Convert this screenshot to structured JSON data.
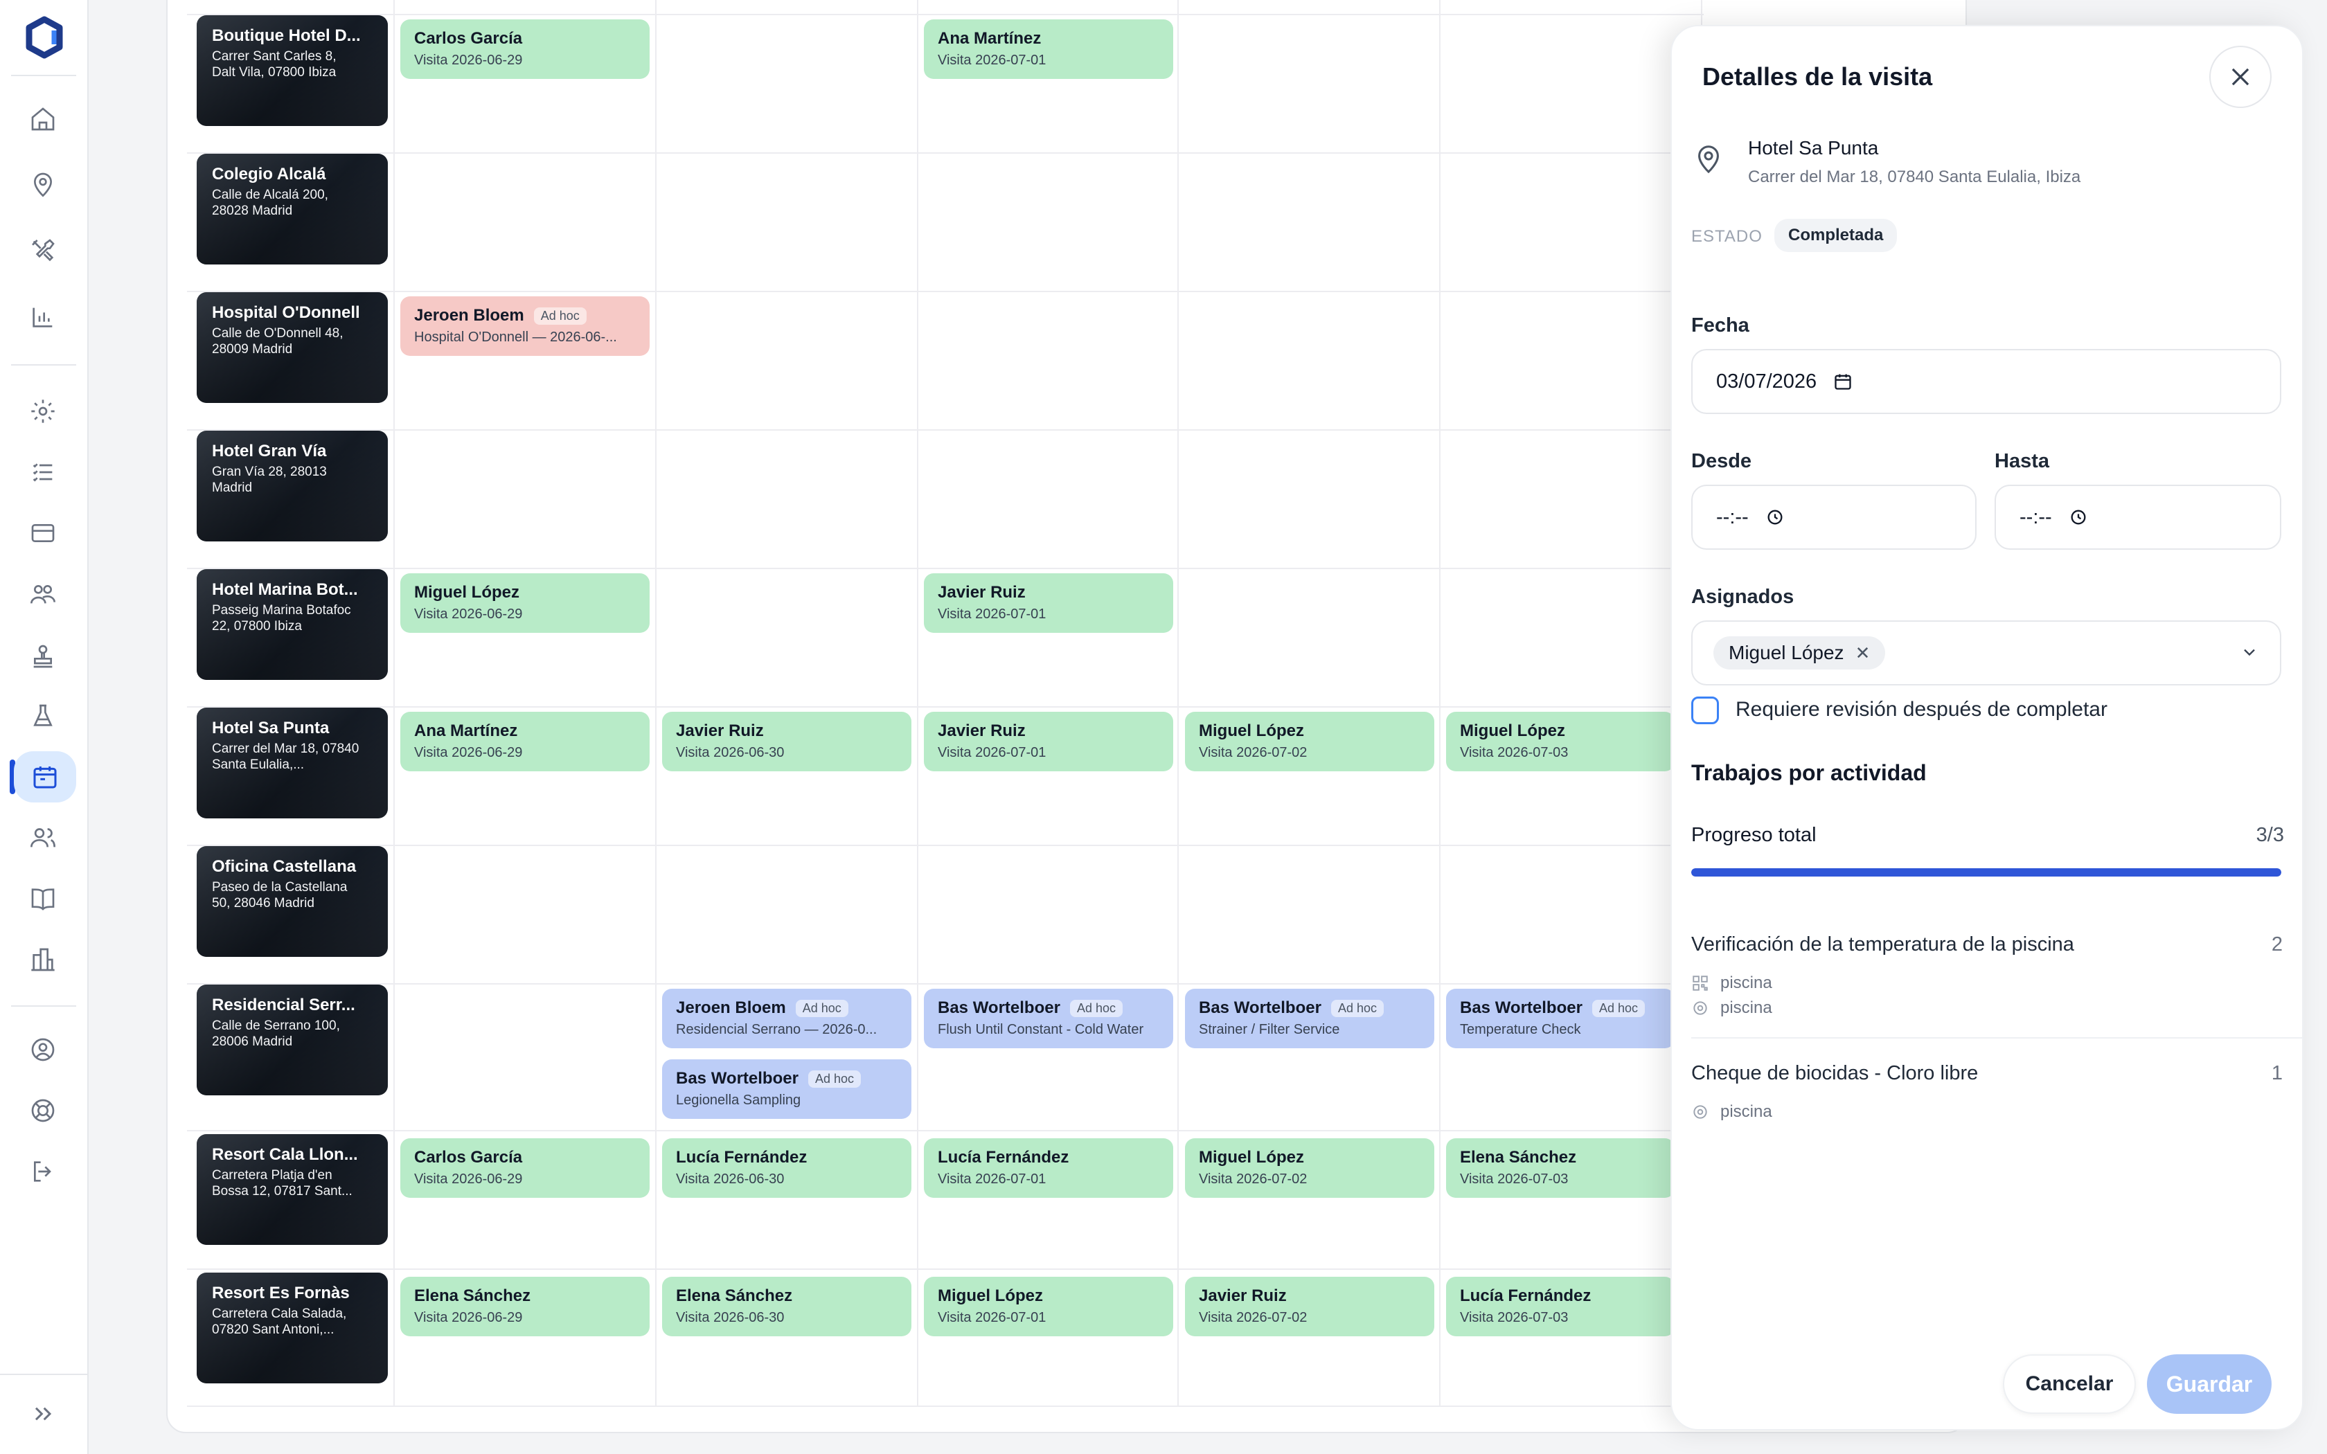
{
  "sidebar": {
    "items": [
      {
        "icon": "home-icon"
      },
      {
        "icon": "map-pin-icon"
      },
      {
        "icon": "tools-icon"
      },
      {
        "icon": "bar-chart-icon"
      },
      {
        "icon": "gear-icon"
      },
      {
        "icon": "checklist-icon"
      },
      {
        "icon": "credit-card-icon"
      },
      {
        "icon": "team-icon"
      },
      {
        "icon": "stamp-icon"
      },
      {
        "icon": "flask-icon"
      },
      {
        "icon": "calendar-icon",
        "active": true
      },
      {
        "icon": "users-icon"
      },
      {
        "icon": "book-icon"
      },
      {
        "icon": "buildings-icon"
      },
      {
        "icon": "account-icon"
      },
      {
        "icon": "support-icon"
      },
      {
        "icon": "logout-icon"
      },
      {
        "icon": "expand-icon"
      }
    ]
  },
  "locations": [
    {
      "name": "Boutique Hotel D...",
      "address": "Carrer Sant Carles 8, Dalt Vila, 07800 Ibiza"
    },
    {
      "name": "Colegio Alcalá",
      "address": "Calle de Alcalá 200, 28028 Madrid"
    },
    {
      "name": "Hospital O'Donnell",
      "address": "Calle de O'Donnell 48, 28009 Madrid"
    },
    {
      "name": "Hotel Gran Vía",
      "address": "Gran Vía 28, 28013 Madrid"
    },
    {
      "name": "Hotel Marina Bot...",
      "address": "Passeig Marina Botafoc 22, 07800 Ibiza"
    },
    {
      "name": "Hotel Sa Punta",
      "address": "Carrer del Mar 18, 07840 Santa Eulalia,..."
    },
    {
      "name": "Oficina Castellana",
      "address": "Paseo de la Castellana 50, 28046 Madrid"
    },
    {
      "name": "Residencial Serr...",
      "address": "Calle de Serrano 100, 28006 Madrid"
    },
    {
      "name": "Resort Cala Llon...",
      "address": "Carretera Platja d'en Bossa 12, 07817 Sant..."
    },
    {
      "name": "Resort Es Fornàs",
      "address": "Carretera Cala Salada, 07820 Sant Antoni,..."
    }
  ],
  "visits": [
    {
      "row": 0,
      "col": 0,
      "color": "g",
      "name": "Carlos García",
      "sub": "Visita 2026-06-29"
    },
    {
      "row": 0,
      "col": 2,
      "color": "g",
      "name": "Ana Martínez",
      "sub": "Visita 2026-07-01"
    },
    {
      "row": 2,
      "col": 0,
      "color": "r",
      "name": "Jeroen Bloem",
      "tag": "Ad hoc",
      "sub": "Hospital O'Donnell — 2026-06-..."
    },
    {
      "row": 4,
      "col": 0,
      "color": "g",
      "name": "Miguel López",
      "sub": "Visita 2026-06-29"
    },
    {
      "row": 4,
      "col": 2,
      "color": "g",
      "name": "Javier Ruiz",
      "sub": "Visita 2026-07-01"
    },
    {
      "row": 5,
      "col": 0,
      "color": "g",
      "name": "Ana Martínez",
      "sub": "Visita 2026-06-29"
    },
    {
      "row": 5,
      "col": 1,
      "color": "g",
      "name": "Javier Ruiz",
      "sub": "Visita 2026-06-30"
    },
    {
      "row": 5,
      "col": 2,
      "color": "g",
      "name": "Javier Ruiz",
      "sub": "Visita 2026-07-01"
    },
    {
      "row": 5,
      "col": 3,
      "color": "g",
      "name": "Miguel López",
      "sub": "Visita 2026-07-02"
    },
    {
      "row": 5,
      "col": 4,
      "color": "g",
      "name": "Miguel López",
      "sub": "Visita 2026-07-03"
    },
    {
      "row": 7,
      "col": 1,
      "color": "b",
      "name": "Jeroen Bloem",
      "tag": "Ad hoc",
      "sub": "Residencial Serrano — 2026-0..."
    },
    {
      "row": 7,
      "col": 1,
      "color": "b",
      "name": "Bas Wortelboer",
      "tag": "Ad hoc",
      "sub": "Legionella Sampling",
      "stack": 1
    },
    {
      "row": 7,
      "col": 2,
      "color": "b",
      "name": "Bas Wortelboer",
      "tag": "Ad hoc",
      "sub": "Flush Until Constant - Cold Water"
    },
    {
      "row": 7,
      "col": 3,
      "color": "b",
      "name": "Bas Wortelboer",
      "tag": "Ad hoc",
      "sub": "Strainer / Filter Service"
    },
    {
      "row": 7,
      "col": 4,
      "color": "b",
      "name": "Bas Wortelboer",
      "tag": "Ad hoc",
      "sub": "Temperature Check"
    },
    {
      "row": 8,
      "col": 0,
      "color": "g",
      "name": "Carlos García",
      "sub": "Visita 2026-06-29"
    },
    {
      "row": 8,
      "col": 1,
      "color": "g",
      "name": "Lucía Fernández",
      "sub": "Visita 2026-06-30"
    },
    {
      "row": 8,
      "col": 2,
      "color": "g",
      "name": "Lucía Fernández",
      "sub": "Visita 2026-07-01"
    },
    {
      "row": 8,
      "col": 3,
      "color": "g",
      "name": "Miguel López",
      "sub": "Visita 2026-07-02"
    },
    {
      "row": 8,
      "col": 4,
      "color": "g",
      "name": "Elena Sánchez",
      "sub": "Visita 2026-07-03"
    },
    {
      "row": 9,
      "col": 0,
      "color": "g",
      "name": "Elena Sánchez",
      "sub": "Visita 2026-06-29"
    },
    {
      "row": 9,
      "col": 1,
      "color": "g",
      "name": "Elena Sánchez",
      "sub": "Visita 2026-06-30"
    },
    {
      "row": 9,
      "col": 2,
      "color": "g",
      "name": "Miguel López",
      "sub": "Visita 2026-07-01"
    },
    {
      "row": 9,
      "col": 3,
      "color": "g",
      "name": "Javier Ruiz",
      "sub": "Visita 2026-07-02"
    },
    {
      "row": 9,
      "col": 4,
      "color": "g",
      "name": "Lucía Fernández",
      "sub": "Visita 2026-07-03"
    }
  ],
  "panel": {
    "title": "Detalles de la visita",
    "location_name": "Hotel Sa Punta",
    "location_address": "Carrer del Mar 18, 07840 Santa Eulalia, Ibiza",
    "estado_label": "ESTADO",
    "estado_value": "Completada",
    "fecha_label": "Fecha",
    "fecha_value": "03/07/2026",
    "desde_label": "Desde",
    "desde_value": "--:--",
    "hasta_label": "Hasta",
    "hasta_value": "--:--",
    "asignados_label": "Asignados",
    "assignee": "Miguel López",
    "checkbox_label": "Requiere revisión después de completar",
    "checkbox_checked": false,
    "section_title": "Trabajos por actividad",
    "progress_label": "Progreso total",
    "progress_value": "3/3",
    "progress_fraction": 1.0,
    "activities": [
      {
        "name": "Verificación de la temperatura de la piscina",
        "count": "2",
        "tags": [
          {
            "icon": "qr-icon",
            "text": "piscina"
          },
          {
            "icon": "cog-icon",
            "text": "piscina"
          }
        ]
      },
      {
        "name": "Cheque de biocidas - Cloro libre",
        "count": "1",
        "tags": [
          {
            "icon": "cog-icon",
            "text": "piscina"
          }
        ]
      }
    ],
    "cancel_label": "Cancelar",
    "save_label": "Guardar"
  },
  "colors": {
    "accent": "#2f56d8",
    "visit_green": "#b8ebc8",
    "visit_red": "#f6c9c6",
    "visit_blue": "#bccdf7",
    "save_disabled": "#a9c4f7"
  }
}
